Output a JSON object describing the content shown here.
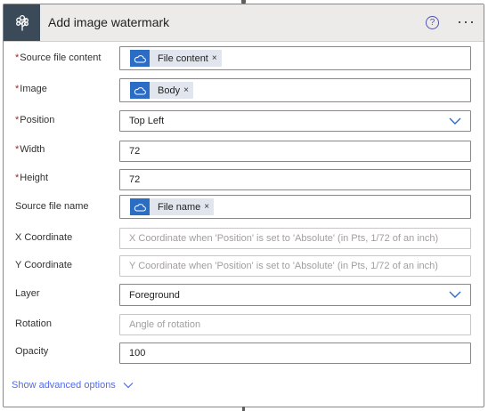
{
  "header": {
    "title": "Add image watermark",
    "help_glyph": "?",
    "more_glyph": "···",
    "app_icon": "tree-icon"
  },
  "fields": {
    "source_file_content": {
      "label": "Source file content",
      "required": "*",
      "token": "File content",
      "token_remove": "×"
    },
    "image": {
      "label": "Image",
      "required": "*",
      "token": "Body",
      "token_remove": "×"
    },
    "position": {
      "label": "Position",
      "required": "*",
      "value": "Top Left"
    },
    "width": {
      "label": "Width",
      "required": "*",
      "value": "72"
    },
    "height": {
      "label": "Height",
      "required": "*",
      "value": "72"
    },
    "source_file_name": {
      "label": "Source file name",
      "token": "File name",
      "token_remove": "×"
    },
    "x_coordinate": {
      "label": "X Coordinate",
      "placeholder": "X Coordinate when 'Position' is set to 'Absolute' (in Pts, 1/72 of an inch)"
    },
    "y_coordinate": {
      "label": "Y Coordinate",
      "placeholder": "Y Coordinate when 'Position' is set to 'Absolute' (in Pts, 1/72 of an inch)"
    },
    "layer": {
      "label": "Layer",
      "value": "Foreground"
    },
    "rotation": {
      "label": "Rotation",
      "placeholder": "Angle of rotation"
    },
    "opacity": {
      "label": "Opacity",
      "value": "100"
    }
  },
  "advanced": {
    "label": "Show advanced options"
  },
  "colors": {
    "header_bg": "#edebe9",
    "app_icon_bg": "#3b4a58",
    "token_icon_bg": "#2b6cc4",
    "token_bg": "#e1e6ee",
    "required": "#a4262c",
    "link": "#4f6bed"
  }
}
